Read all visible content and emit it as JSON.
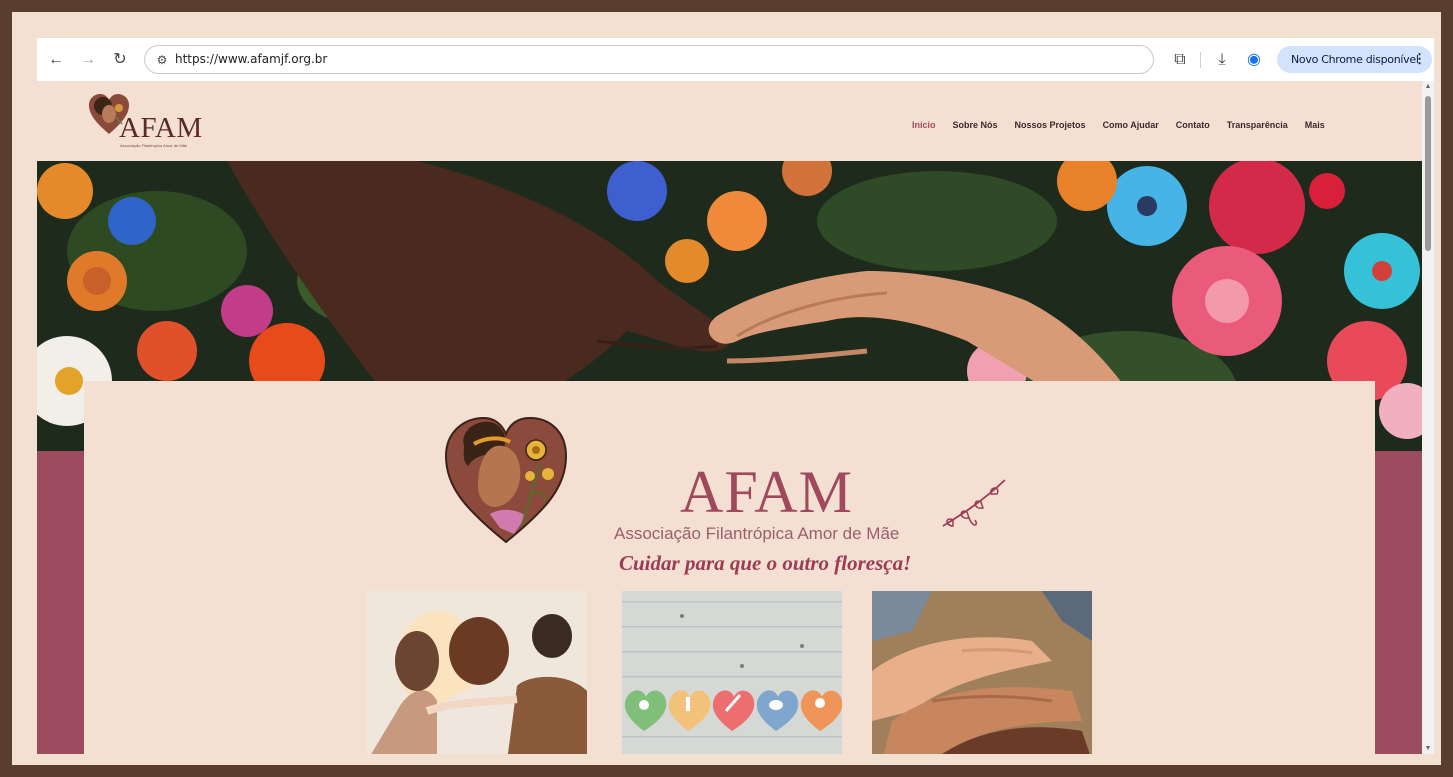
{
  "browser": {
    "url": "https://www.afamjf.org.br",
    "update_button": "Novo Chrome disponível"
  },
  "site": {
    "logo_text": "AFAM",
    "logo_subtext": "Associação Filantrópica Amor de Mãe",
    "nav": [
      {
        "label": "Início",
        "active": true
      },
      {
        "label": "Sobre Nós",
        "active": false
      },
      {
        "label": "Nossos Projetos",
        "active": false
      },
      {
        "label": "Como Ajudar",
        "active": false
      },
      {
        "label": "Contato",
        "active": false
      },
      {
        "label": "Transparência",
        "active": false
      },
      {
        "label": "Mais",
        "active": false
      }
    ],
    "hero_title": "AFAM",
    "hero_subtitle": "Associação Filantrópica Amor de Mãe",
    "hero_tagline": "Cuidar para que o outro floresça!"
  },
  "colors": {
    "frame": "#593d2f",
    "page_bg": "#f4e0d3",
    "accent": "#9b4c5f",
    "title": "#a0485c"
  }
}
